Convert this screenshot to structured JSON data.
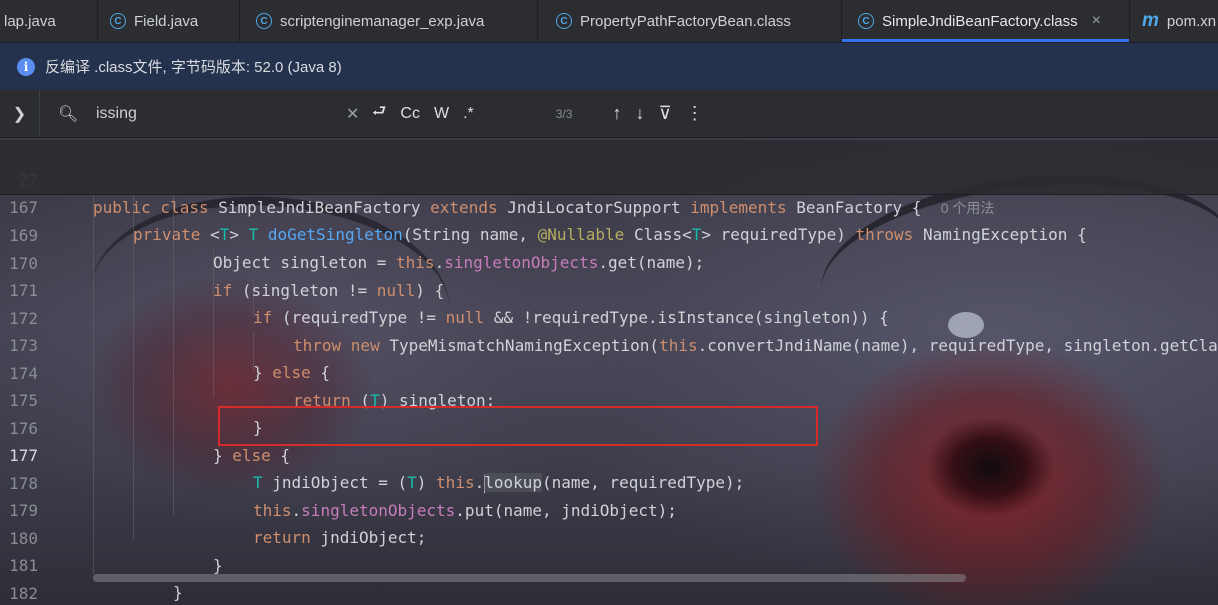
{
  "tabs": [
    {
      "label": "lap.java",
      "icon": "none",
      "active": false
    },
    {
      "label": "Field.java",
      "icon": "java-class-icon",
      "active": false
    },
    {
      "label": "scriptenginemanager_exp.java",
      "icon": "java-class-icon",
      "active": false
    },
    {
      "label": "PropertyPathFactoryBean.class",
      "icon": "class-file-icon",
      "active": false
    },
    {
      "label": "SimpleJndiBeanFactory.class",
      "icon": "class-file-icon",
      "active": true
    },
    {
      "label": "pom.xn",
      "icon": "maven-icon",
      "active": false
    }
  ],
  "tab_close": "×",
  "banner": {
    "icon": "info-icon",
    "text": "反编译 .class文件, 字节码版本: 52.0 (Java 8)"
  },
  "search": {
    "query": "issing",
    "match_case_label": "Cc",
    "words_label": "W",
    "regex_label": ".*",
    "count": "3/3"
  },
  "code": {
    "sticky": [
      {
        "num": "27",
        "usage_hint": "0 个用法"
      },
      {
        "num": "167"
      }
    ],
    "lines": [
      "169",
      "170",
      "171",
      "172",
      "173",
      "174",
      "175",
      "176",
      "177",
      "178",
      "179",
      "180",
      "181",
      "182"
    ],
    "current_line": "177"
  }
}
